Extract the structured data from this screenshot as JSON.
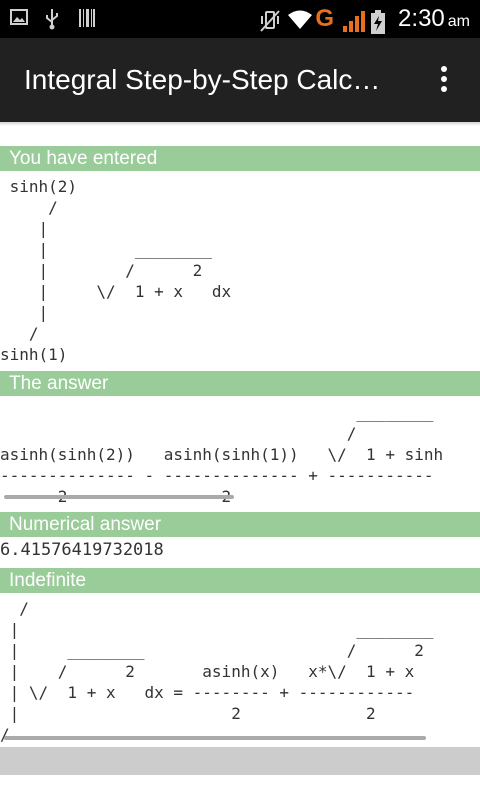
{
  "status_bar": {
    "time": "2:30",
    "ampm": "am",
    "network_letter": "G",
    "left_icons": [
      "image-notification-icon",
      "usb-icon",
      "barcode-icon"
    ],
    "right_icons": [
      "vibrate-icon",
      "wifi-icon",
      "signal-icon",
      "battery-charging-icon"
    ]
  },
  "action_bar": {
    "title": "Integral Step-by-Step Calc…",
    "overflow_icon": "more-vert-icon"
  },
  "sections": {
    "entered_header": "You have entered",
    "entered_math": " sinh(2)\n     /\n    |\n    |         ________\n    |        /      2\n    |     \\/  1 + x   dx\n    |\n   /\nsinh(1)",
    "answer_header": "The answer",
    "answer_math": "                                     ________\n                                    /\nasinh(sinh(2))   asinh(sinh(1))   \\/  1 + sinh\n-------------- - -------------- + -----------\n      2                2",
    "numerical_header": "Numerical answer",
    "numerical_value": "6.41576419732018",
    "indefinite_header": "Indefinite",
    "indefinite_math": "  /\n |                                   ________\n |     ________                     /      2\n |    /      2       asinh(x)   x*\\/  1 + x\n | \\/  1 + x   dx = -------- + ------------\n |                      2             2\n/"
  },
  "colors": {
    "section_header_bg": "#99cc99",
    "action_bar_bg": "#212121",
    "status_bar_bg": "#000000",
    "network_letter": "#e76f1e"
  }
}
